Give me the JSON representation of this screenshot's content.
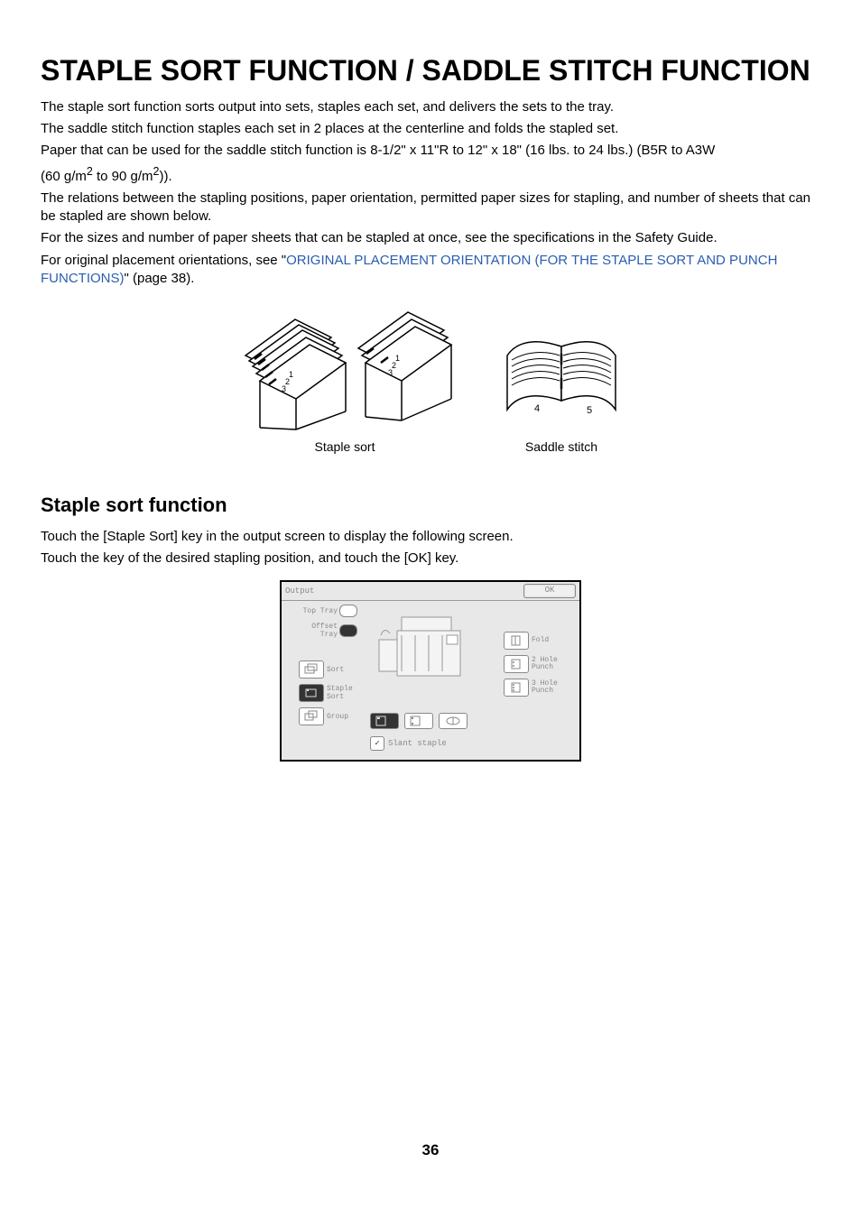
{
  "title": "STAPLE SORT FUNCTION / SADDLE STITCH FUNCTION",
  "body": {
    "p1": "The staple sort function sorts output into sets, staples each set, and delivers the sets to the tray.",
    "p2": "The saddle stitch function staples each set in 2 places at the centerline and folds the stapled set.",
    "p3a": "Paper that can be used for the saddle stitch function is 8-1/2\" x 11\"R to 12\" x 18\" (16 lbs. to 24 lbs.) (B5R to A3W",
    "p3b_prefix": "(60 ",
    "p3b_unit1": "g",
    "p3b_per1": "/m",
    "p3b_sup1": "2",
    "p3b_mid": " to 90 ",
    "p3b_unit2": "g",
    "p3b_per2": "/m",
    "p3b_sup2": "2",
    "p3b_suffix": ")).",
    "p4": "The relations between the stapling positions, paper orientation, permitted paper sizes for stapling, and number of sheets that can be stapled are shown below.",
    "p5": "For the sizes and number of paper sheets that can be stapled at once, see the specifications in the Safety Guide.",
    "p6a": "For original placement orientations, see \"",
    "p6_link": "ORIGINAL PLACEMENT ORIENTATION (FOR THE STAPLE SORT AND PUNCH FUNCTIONS)",
    "p6b": "\" (page 38)."
  },
  "illus": {
    "staple_sort": "Staple sort",
    "saddle_stitch": "Saddle stitch"
  },
  "section2": {
    "heading": "Staple sort function",
    "p1": "Touch the [Staple Sort] key in the output screen to display the following screen.",
    "p2": "Touch the key of the desired stapling position, and touch the [OK] key."
  },
  "panel": {
    "title": "Output",
    "ok": "OK",
    "left": {
      "top_tray": "Top Tray",
      "offset_tray": "Offset Tray",
      "sort": "Sort",
      "staple_sort": "Staple\nSort",
      "group": "Group"
    },
    "right": {
      "fold": "Fold",
      "punch2": "2 Hole\nPunch",
      "punch3": "3 Hole\nPunch"
    },
    "slant": "Slant staple"
  },
  "page_number": "36"
}
